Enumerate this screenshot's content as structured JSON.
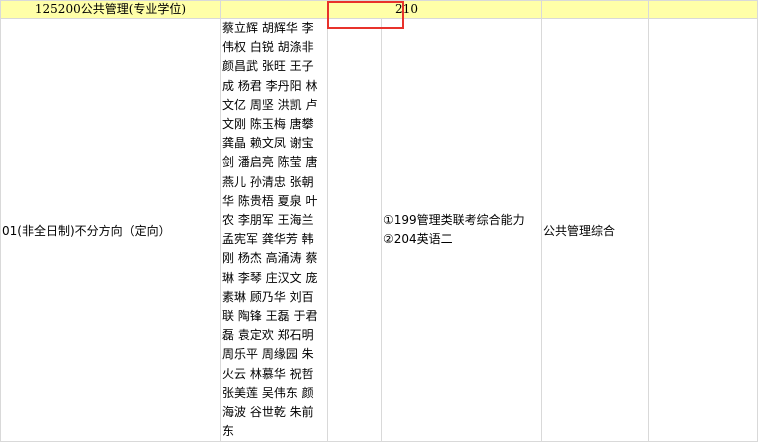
{
  "major_row": {
    "major": "125200公共管理(专业学位)",
    "enrollment": "210"
  },
  "direction_row": {
    "direction": "01(非全日制)不分方向（定向）",
    "advisors": [
      "蔡立辉 胡辉华 李伟权 白锐 胡涤非 颜昌武 张旺 王子成 杨君 李丹阳 林文亿 周坚 洪凯 卢文刚 陈玉梅 唐攀 龚晶 赖文凤 谢宝",
      "剑 潘启亮 陈莹 唐燕儿 孙清忠 张朝 华 陈贵梧 夏泉 叶农 李朋军 王海兰 孟宪军 龚华芳 韩刚 杨杰 高涌涛 蔡琳 李琴 庄汉文 庞素琳 顾乃华 刘百联 陶锋 王磊 于君磊 袁定欢 郑石明",
      "周乐平 周缘园 朱火云 林慕华 祝哲 张美莲 吴伟东 颜海波 谷世乾 朱前东"
    ],
    "exams": [
      "①199管理类联考综合能力",
      "②204英语二"
    ],
    "retest": "公共管理综合"
  },
  "colors": {
    "header_bg": "#ffffa8",
    "highlight": "#e8322b",
    "border": "#d9d9d9"
  }
}
